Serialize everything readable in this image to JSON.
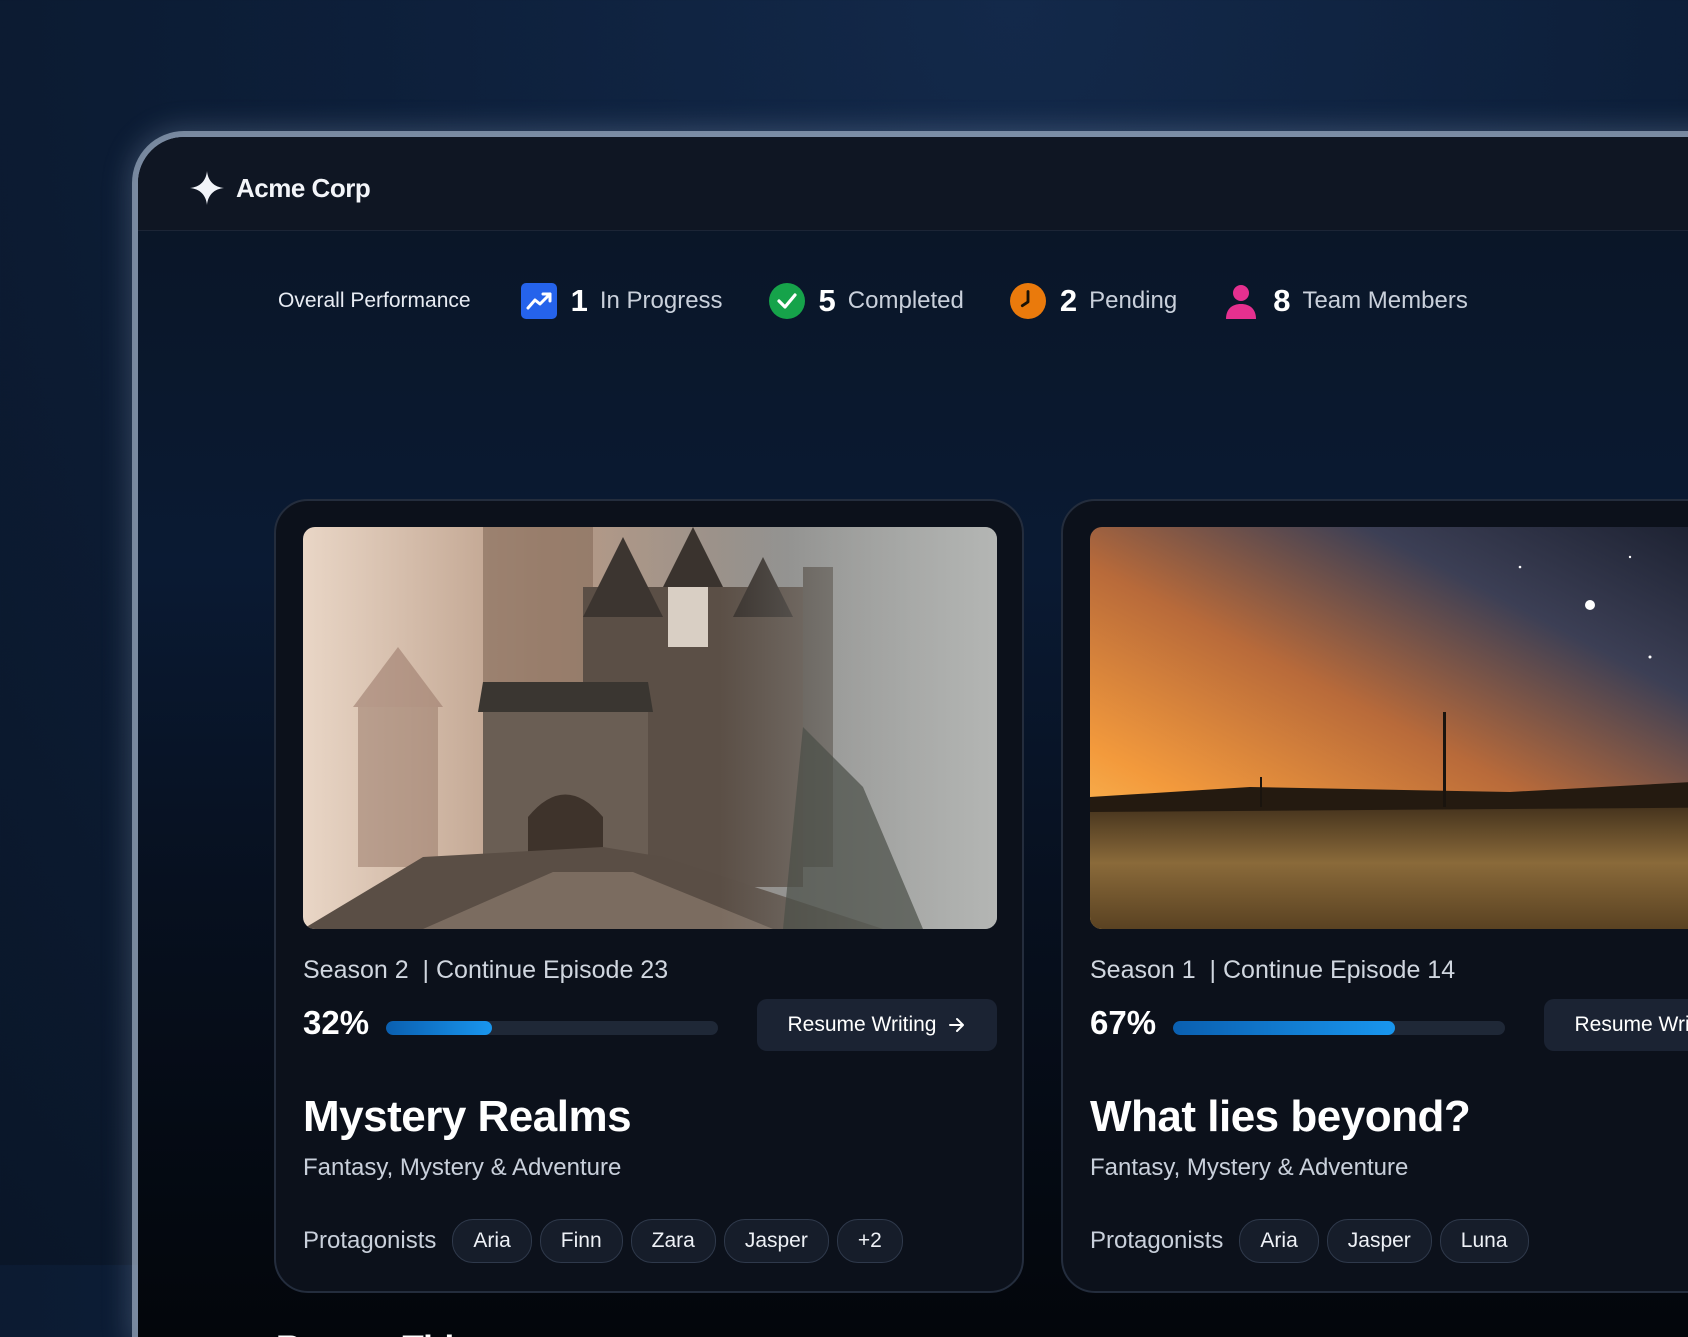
{
  "brand": {
    "name": "Acme Corp",
    "icon": "sparkle-icon"
  },
  "stats": {
    "label": "Overall Performance",
    "items": [
      {
        "value": "1",
        "label": "In Progress",
        "icon": "trending-up-icon",
        "color": "#2563eb"
      },
      {
        "value": "5",
        "label": "Completed",
        "icon": "check-circle-icon",
        "color": "#16a34a"
      },
      {
        "value": "2",
        "label": "Pending",
        "icon": "clock-icon",
        "color": "#ea7a0c"
      },
      {
        "value": "8",
        "label": "Team Members",
        "icon": "user-icon",
        "color": "#e5308f"
      }
    ]
  },
  "projects": [
    {
      "season": "Season 2",
      "episode": "| Continue Episode 23",
      "progress_label": "32%",
      "progress": 0.32,
      "resume_label": "Resume Writing",
      "title": "Mystery Realms",
      "genre": "Fantasy, Mystery & Adventure",
      "protagonists_label": "Protagonists",
      "protagonists": [
        "Aria",
        "Finn",
        "Zara",
        "Jasper",
        "+2"
      ]
    },
    {
      "season": "Season 1",
      "episode": "| Continue Episode 14",
      "progress_label": "67%",
      "progress": 0.67,
      "resume_label": "Resume Writing",
      "title": "What lies beyond?",
      "genre": "Fantasy, Mystery & Adventure",
      "protagonists_label": "Protagonists",
      "protagonists": [
        "Aria",
        "Jasper",
        "Luna"
      ]
    }
  ],
  "recent": {
    "title": "Recent Titles"
  }
}
